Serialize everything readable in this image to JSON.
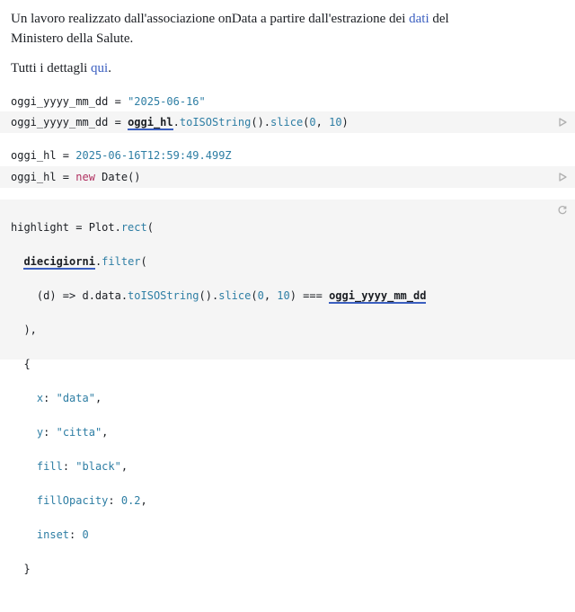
{
  "intro": {
    "line1_before": "Un lavoro realizzato dall'associazione onData a partire dall'estrazione dei",
    "line1_link": "dati",
    "line1_after": "del",
    "line2": "Ministero della Salute."
  },
  "details": {
    "before": "Tutti i dettagli",
    "link": "qui",
    "after": "."
  },
  "cell1": {
    "output_name": "oggi_yyyy_mm_dd",
    "output_eq": " = ",
    "output_value": "\"2025-06-16\"",
    "code_name": "oggi_yyyy_mm_dd",
    "code_eq": " = ",
    "code_ref": "oggi_hl",
    "code_rest1": ".",
    "code_method1": "toISOString",
    "code_paren1": "().",
    "code_method2": "slice",
    "code_open": "(",
    "code_arg1": "0",
    "code_comma": ", ",
    "code_arg2": "10",
    "code_close": ")"
  },
  "cell2": {
    "output_name": "oggi_hl",
    "output_eq": " = ",
    "output_value": "2025-06-16T12:59:49.499Z",
    "code_name": "oggi_hl",
    "code_eq": " = ",
    "code_kw": "new",
    "code_rest": " Date()"
  },
  "cell3": {
    "lines": [
      "highlight = Plot.rect(",
      "  diecigiorni.filter(",
      "    (d) => d.data.toISOString().slice(0, 10) === oggi_yyyy_mm_dd",
      "  ),",
      "  {",
      "    x: \"data\",",
      "    y: \"citta\",",
      "    fill: \"black\",",
      "    fillOpacity: 0.2,",
      "    inset: 0",
      "  }"
    ]
  },
  "icons": {
    "run": "play-icon",
    "pending": "refresh-icon"
  },
  "colors": {
    "link": "#3b5fc0",
    "string": "#2e7ea4",
    "keyword": "#b03060",
    "cell_bg": "#f5f5f5"
  }
}
